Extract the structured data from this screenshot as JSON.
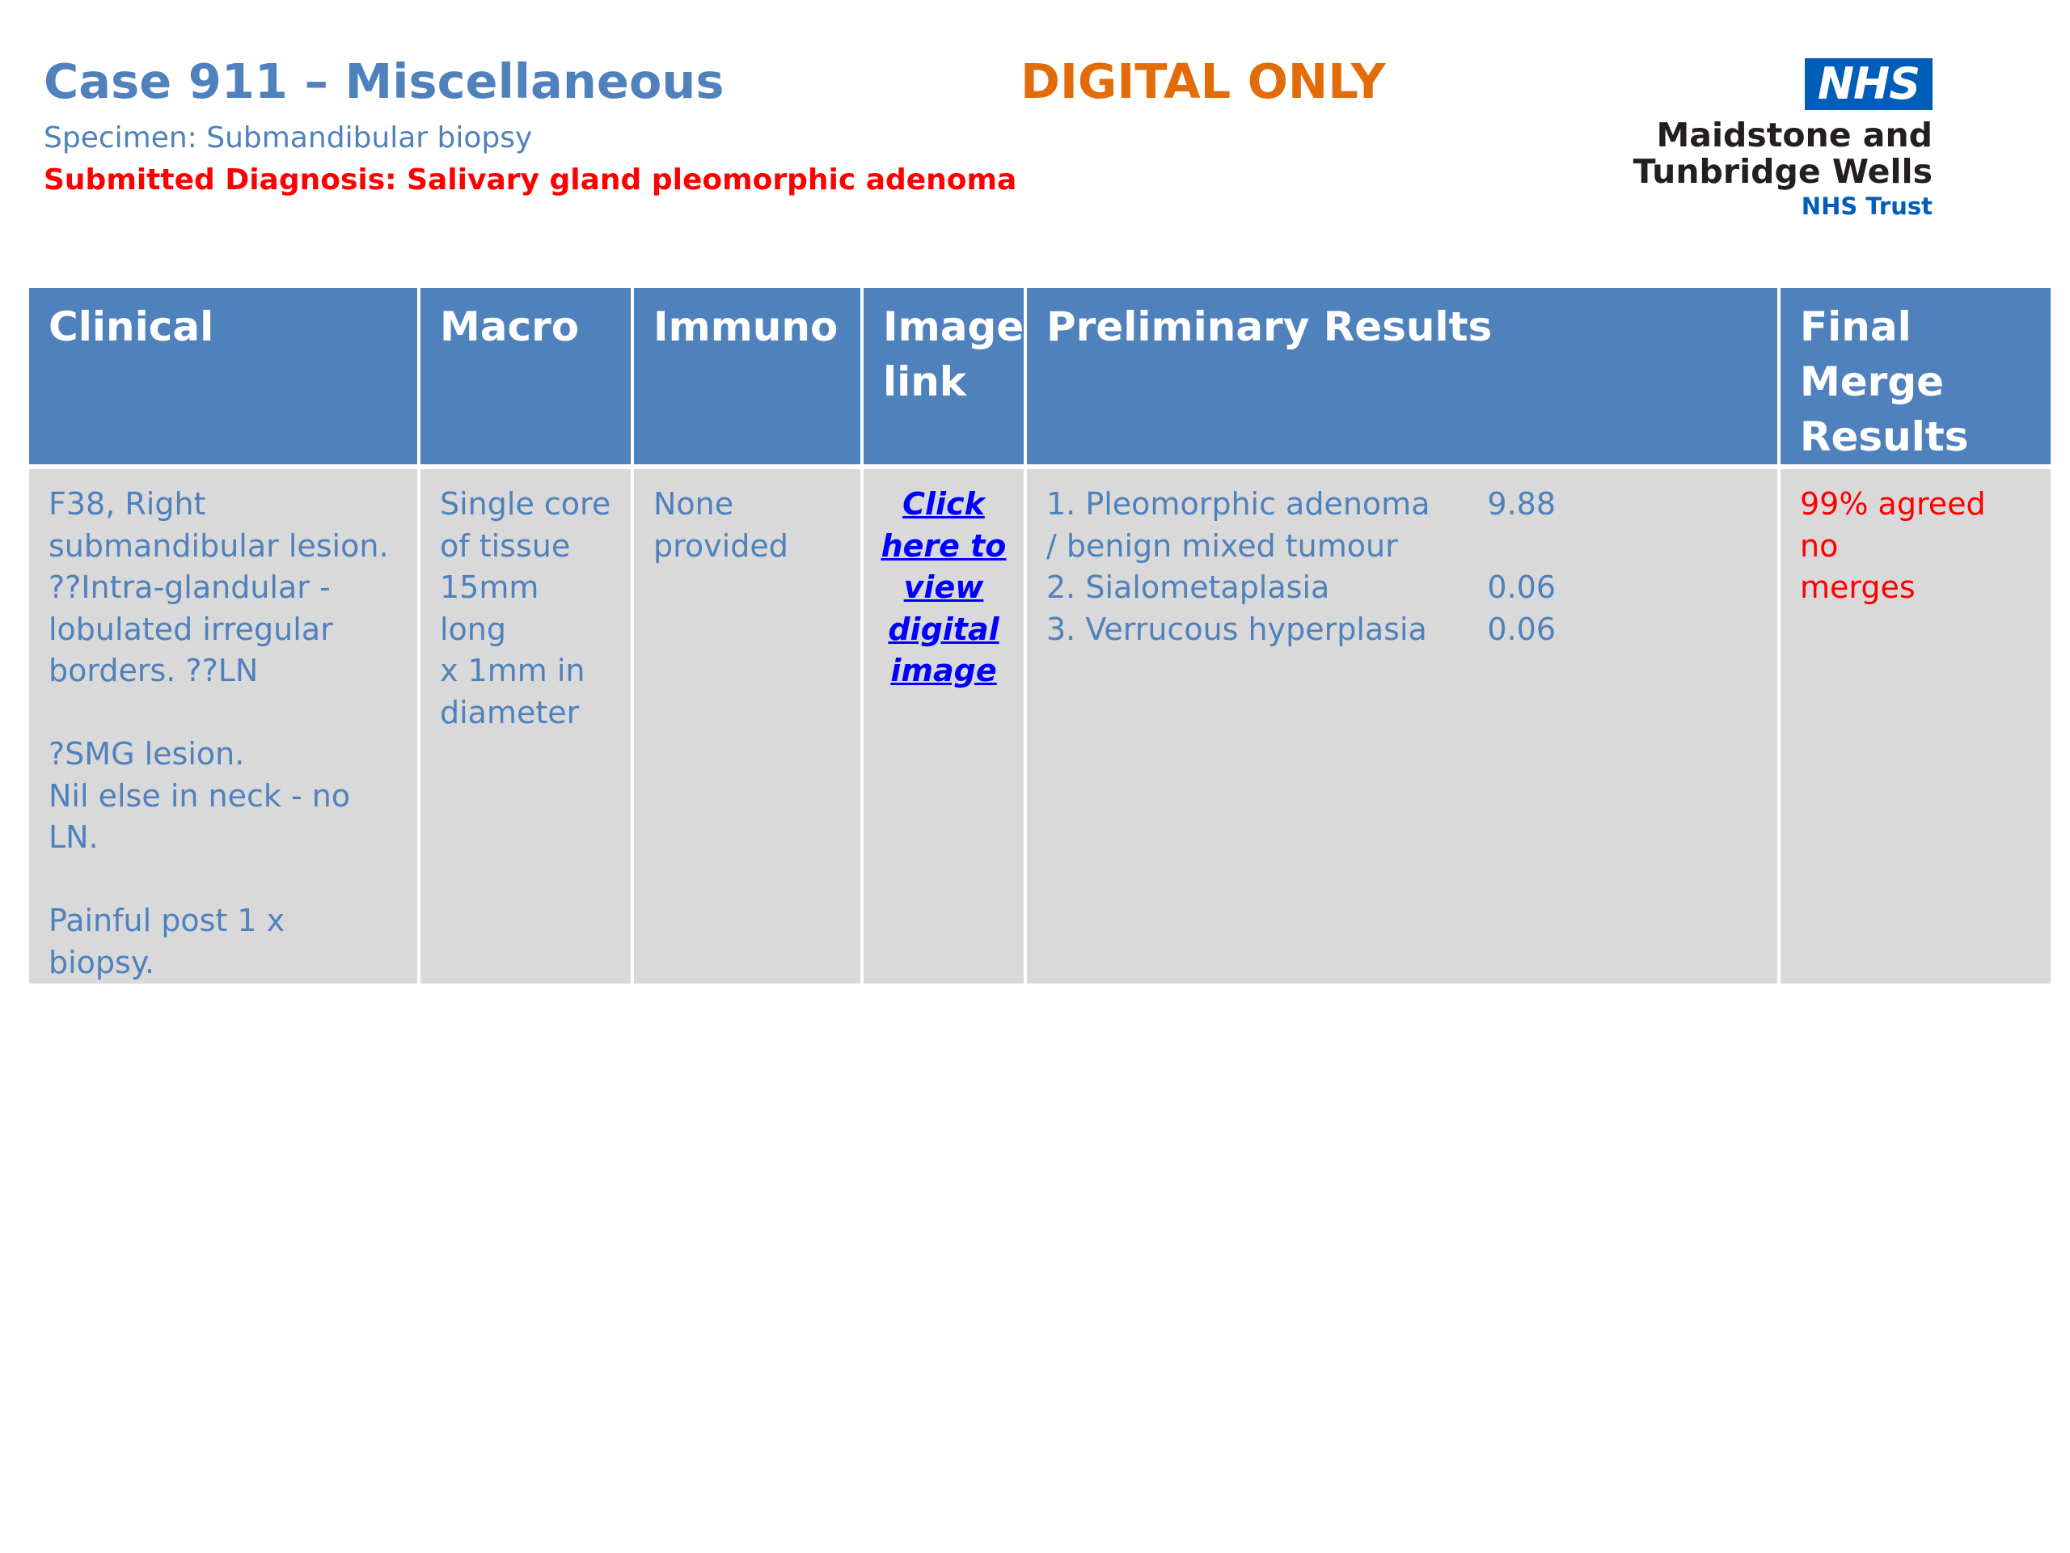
{
  "header": {
    "title": "Case 911 – Miscellaneous",
    "badge": "DIGITAL ONLY",
    "specimen": "Specimen: Submandibular biopsy",
    "diagnosis": "Submitted Diagnosis: Salivary gland pleomorphic adenoma"
  },
  "logo": {
    "badge": "NHS",
    "line1": "Maidstone and",
    "line2": "Tunbridge Wells",
    "line3": "NHS Trust"
  },
  "table": {
    "headers": [
      "Clinical",
      "Macro",
      "Immuno",
      "Image link",
      "Preliminary Results",
      "Final Merge Results"
    ],
    "clinical": "F38, Right\nsubmandibular lesion.\n??Intra-glandular -\nlobulated irregular\nborders.  ??LN\n\n?SMG lesion.\nNil else in neck - no LN.\n\nPainful post 1 x biopsy.",
    "macro": "Single core\nof tissue\n15mm long\nx 1mm in\ndiameter",
    "immuno": "None\nprovided",
    "image_link": "Click\nhere to\nview\ndigital\nimage",
    "preliminary": [
      {
        "label": "1. Pleomorphic adenoma",
        "score": "9.88"
      },
      {
        "label": "/ benign mixed tumour",
        "score": ""
      },
      {
        "label": "2. Sialometaplasia",
        "score": "0.06"
      },
      {
        "label": "3. Verrucous hyperplasia",
        "score": "0.06"
      }
    ],
    "final": "99% agreed no\nmerges"
  },
  "colors": {
    "accent": "#4f81bd",
    "header_bg": "#4f81bd",
    "cell_bg": "#d9d9d9",
    "orange": "#e36c0a",
    "red": "#ff0000",
    "nhs_blue": "#005eb8"
  }
}
